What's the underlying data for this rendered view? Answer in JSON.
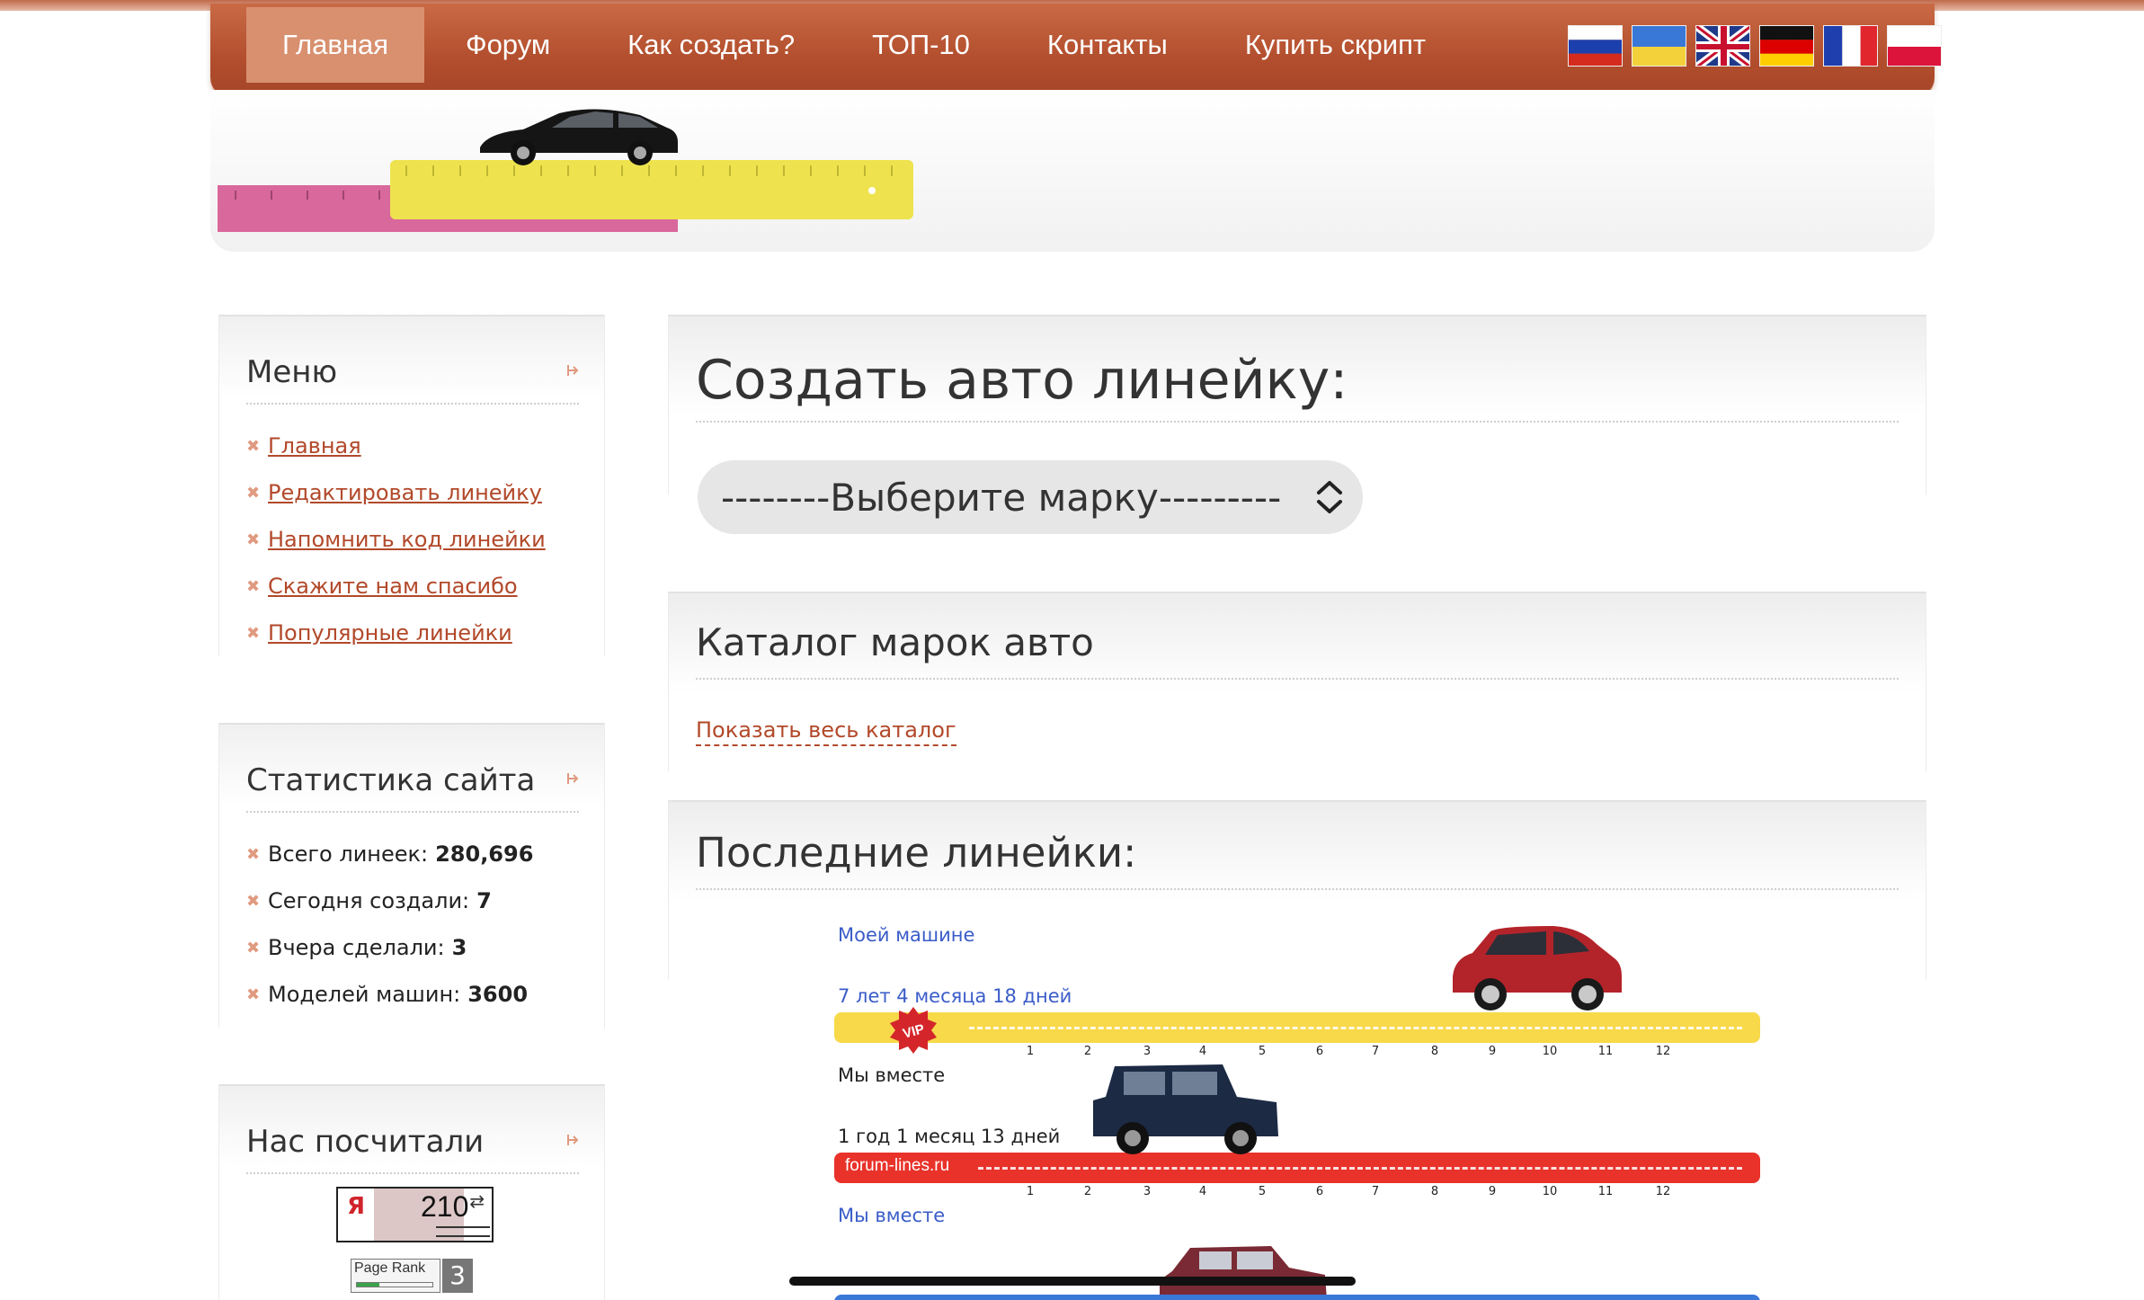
{
  "nav": {
    "items": [
      {
        "label": "Главная",
        "active": true
      },
      {
        "label": "Форум",
        "active": false
      },
      {
        "label": "Как создать?",
        "active": false
      },
      {
        "label": "ТОП-10",
        "active": false
      },
      {
        "label": "Контакты",
        "active": false
      },
      {
        "label": "Купить скрипт",
        "active": false
      }
    ],
    "flags": [
      "russia-flag",
      "ukraine-flag",
      "uk-flag",
      "germany-flag",
      "france-flag",
      "poland-flag"
    ]
  },
  "sidebar": {
    "menu": {
      "title": "Меню",
      "items": [
        {
          "label": "Главная"
        },
        {
          "label": "Редактировать линейку"
        },
        {
          "label": "Напомнить код линейки"
        },
        {
          "label": "Скажите нам спасибо"
        },
        {
          "label": "Популярные линейки"
        }
      ]
    },
    "stats": {
      "title": "Статистика сайта",
      "items": [
        {
          "label": "Всего линеек:",
          "value": "280,696"
        },
        {
          "label": "Сегодня создали:",
          "value": "7"
        },
        {
          "label": "Вчера сделали:",
          "value": "3"
        },
        {
          "label": "Моделей машин:",
          "value": "3600"
        }
      ]
    },
    "counters": {
      "title": "Нас посчитали",
      "yandex_letter": "Я",
      "yandex_value": "210",
      "pagerank_label": "Page Rank",
      "pagerank_value": "3"
    }
  },
  "main": {
    "create": {
      "title": "Создать авто линейку:",
      "select_value": "--------Выберите марку---------"
    },
    "catalog": {
      "title": "Каталог марок авто",
      "link": "Показать весь каталог"
    },
    "latest": {
      "title": "Последние линейки:",
      "tick_labels": [
        "1",
        "2",
        "3",
        "4",
        "5",
        "6",
        "7",
        "8",
        "9",
        "10",
        "11",
        "12"
      ],
      "rulers": [
        {
          "name": "Моей машине",
          "time": "7 лет 4 месяца 18 дней",
          "bar_color": "#f7d94a",
          "name_color": "#3a5cc8",
          "badge": "VIP",
          "bar_text": ""
        },
        {
          "name": "Мы вместе",
          "time": "1 год 1 месяц 13 дней",
          "bar_color": "#e8322a",
          "name_color": "#222222",
          "badge": "",
          "bar_text": "forum-lines.ru"
        },
        {
          "name": "Мы вместе",
          "time": "",
          "bar_color": "#3a78d8",
          "name_color": "#3a5cc8",
          "badge": "",
          "bar_text": ""
        }
      ]
    }
  },
  "colors": {
    "accent": "#b2492a",
    "nav_bg": "#b24e2d",
    "link_blue": "#3a5cc8"
  }
}
